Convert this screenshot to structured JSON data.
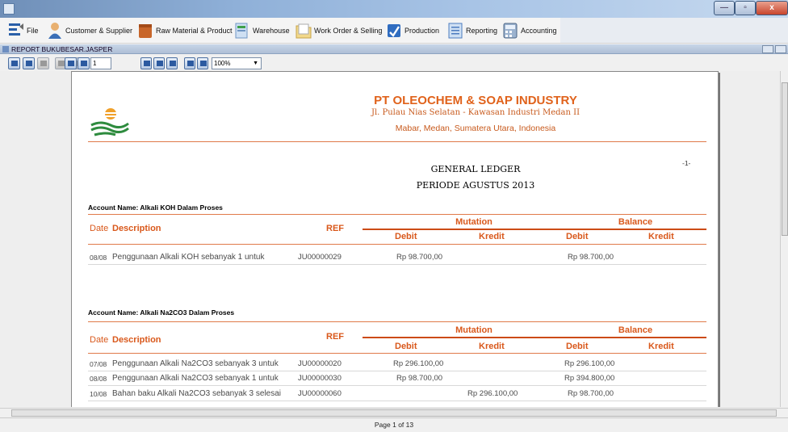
{
  "window": {
    "min": "—",
    "restore": "▫",
    "close": "x"
  },
  "menu": {
    "items": [
      {
        "label": "File",
        "icon": "file-icon"
      },
      {
        "label": "Customer & Supplier",
        "icon": "person-icon"
      },
      {
        "label": "Raw Material & Product",
        "icon": "box-icon"
      },
      {
        "label": "Warehouse",
        "icon": "warehouse-icon"
      },
      {
        "label": "Work Order & Selling",
        "icon": "folder-icon"
      },
      {
        "label": "Production",
        "icon": "production-icon"
      },
      {
        "label": "Reporting",
        "icon": "report-icon"
      },
      {
        "label": "Accounting",
        "icon": "accounting-icon"
      }
    ]
  },
  "frame": {
    "title": "REPORT BUKUBESAR.JASPER"
  },
  "toolbar": {
    "page_input": "1",
    "zoom": "100%"
  },
  "report": {
    "page_label": "-1-",
    "company": "PT OLEOCHEM & SOAP INDUSTRY",
    "address1": "Jl. Pulau Nias Selatan - Kawasan Industri Medan II",
    "address2": "Mabar, Medan, Sumatera Utara, Indonesia",
    "title": "GENERAL LEDGER",
    "period": "PERIODE AGUSTUS 2013",
    "headers": {
      "date": "Date",
      "description": "Description",
      "ref": "REF",
      "mutation": "Mutation",
      "balance": "Balance",
      "debit": "Debit",
      "kredit": "Kredit"
    },
    "accounts": [
      {
        "name": "Account Name: Alkali KOH Dalam Proses",
        "rows": [
          {
            "date": "08/08",
            "description": "Penggunaan Alkali KOH sebanyak 1 untuk",
            "ref": "JU00000029",
            "mut_debit": "Rp 98.700,00",
            "mut_kredit": "",
            "bal_debit": "Rp 98.700,00",
            "bal_kredit": ""
          }
        ]
      },
      {
        "name": "Account Name: Alkali Na2CO3 Dalam Proses",
        "rows": [
          {
            "date": "07/08",
            "description": "Penggunaan Alkali Na2CO3 sebanyak 3 untuk",
            "ref": "JU00000020",
            "mut_debit": "Rp 296.100,00",
            "mut_kredit": "",
            "bal_debit": "Rp 296.100,00",
            "bal_kredit": ""
          },
          {
            "date": "08/08",
            "description": "Penggunaan Alkali Na2CO3 sebanyak 1 untuk",
            "ref": "JU00000030",
            "mut_debit": "Rp 98.700,00",
            "mut_kredit": "",
            "bal_debit": "Rp 394.800,00",
            "bal_kredit": ""
          },
          {
            "date": "10/08",
            "description": "Bahan baku Alkali Na2CO3 sebanyak 3 selesai",
            "ref": "JU00000060",
            "mut_debit": "",
            "mut_kredit": "Rp 296.100,00",
            "bal_debit": "Rp 98.700,00",
            "bal_kredit": ""
          }
        ]
      }
    ]
  },
  "status": {
    "page_of": "Page 1 of 13"
  }
}
